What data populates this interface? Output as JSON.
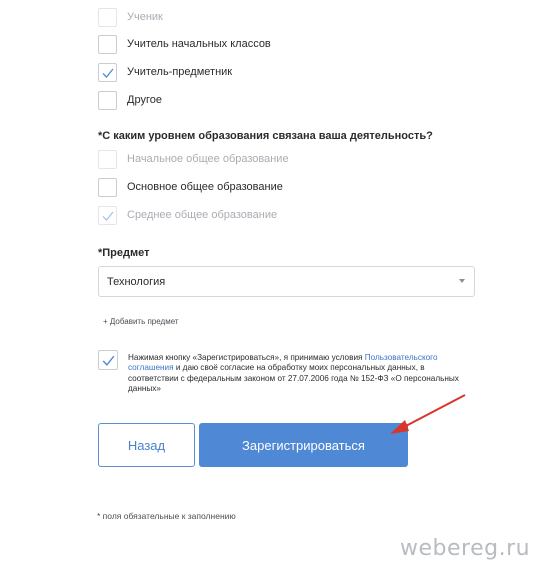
{
  "occupation_options": [
    {
      "label": "Ученик",
      "checked": false,
      "faded": true
    },
    {
      "label": "Учитель начальных классов",
      "checked": false,
      "faded": false
    },
    {
      "label": "Учитель-предметник",
      "checked": true,
      "faded": false
    },
    {
      "label": "Другое",
      "checked": false,
      "faded": false
    }
  ],
  "education_section": {
    "title": "*С каким уровнем образования связана ваша деятельность?",
    "options": [
      {
        "label": "Начальное общее образование",
        "checked": false,
        "faded": true
      },
      {
        "label": "Основное общее образование",
        "checked": false,
        "faded": false
      },
      {
        "label": "Среднее общее образование",
        "checked": true,
        "faded": true
      }
    ]
  },
  "subject": {
    "label": "*Предмет",
    "value": "Технология",
    "add_link": "+ Добавить предмет"
  },
  "consent": {
    "checked": true,
    "text_before": "Нажимая кнопку «Зарегистрироваться», я принимаю условия",
    "link": "Пользовательского соглашения",
    "text_after": "и даю своё согласие на обработку моих персональных данных, в соответствии с федеральным законом от 27.07.2006 года № 152-ФЗ «О персональных данных»"
  },
  "buttons": {
    "back": "Назад",
    "register": "Зарегистрироваться"
  },
  "footnote": "* поля обязательные к заполнению",
  "watermark": "webereg.ru",
  "colors": {
    "accent": "#4f89d6",
    "checkmark": "#4f89d6",
    "arrow": "#d9362b"
  }
}
